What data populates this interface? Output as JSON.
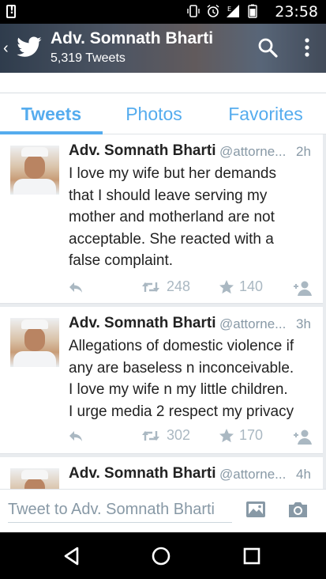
{
  "status_bar": {
    "time": "23:58",
    "icons": [
      "vibrate-icon",
      "alarm-icon",
      "signal-icon",
      "battery-icon"
    ],
    "network_label": "E"
  },
  "header": {
    "title": "Adv. Somnath Bharti",
    "tweet_count": "5,319 Tweets"
  },
  "tabs": [
    {
      "label": "Tweets",
      "selected": true
    },
    {
      "label": "Photos",
      "selected": false
    },
    {
      "label": "Favorites",
      "selected": false
    }
  ],
  "tweets": [
    {
      "name": "Adv. Somnath Bharti",
      "handle": "@attorne...",
      "time": "2h",
      "lines": [
        "I love my wife but her demands",
        "that I should leave serving my",
        "mother and motherland are not",
        "acceptable. She reacted with a",
        "false complaint."
      ],
      "retweets": "248",
      "favorites": "140"
    },
    {
      "name": "Adv. Somnath Bharti",
      "handle": "@attorne...",
      "time": "3h",
      "lines": [
        "Allegations of domestic violence if",
        "any are baseless n inconceivable.",
        "I love my wife n my little children.",
        "I urge media 2 respect my privacy"
      ],
      "retweets": "302",
      "favorites": "170"
    },
    {
      "name": "Adv. Somnath Bharti",
      "handle": "@attorne...",
      "time": "4h"
    }
  ],
  "compose": {
    "placeholder": "Tweet to Adv. Somnath Bharti"
  },
  "colors": {
    "accent": "#55acee",
    "action_gray": "#aab8c2",
    "meta_gray": "#8899a6"
  }
}
